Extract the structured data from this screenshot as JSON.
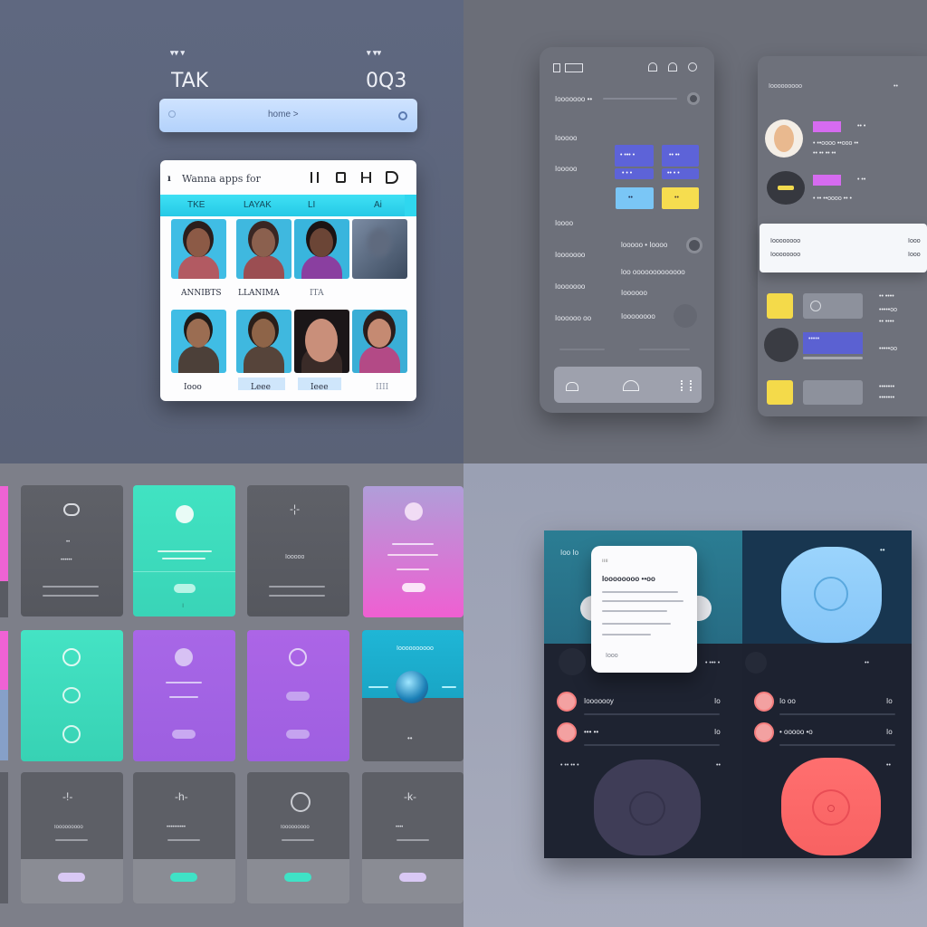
{
  "q1": {
    "status_left": "▾▾ ▾",
    "status_right": "▾ ▾▾",
    "big_left": "TAK",
    "big_right": "0Q3",
    "search_label": "home >",
    "card_title": "Wanna apps for",
    "card_icons": [
      "bars-icon",
      "grid-icon",
      "h-icon",
      "m-icon"
    ],
    "col_headers": [
      "TKE",
      "LAYAK",
      "LI",
      "Ai"
    ],
    "row1_captions": [
      "ANNIBTS",
      "LLANIMA",
      "ITA",
      ""
    ],
    "row2_captions": [
      "Iooo",
      "Leee",
      "Ieee",
      "IIII"
    ]
  },
  "q2": {
    "phone_top_icons": [
      "menu-icon",
      "home-icon",
      "lock-icon",
      "settings-icon"
    ],
    "phone_rows": [
      "Iooooooo ••",
      "Iooooo",
      "Iooooo",
      "Ioooo",
      "Iooooooo",
      "Iooooooo",
      "Ioooooo oo"
    ],
    "chip_labels": [
      "• ••• •",
      "•• ••",
      "• • •",
      "•• • •",
      "••",
      "••"
    ],
    "phone_mid_text": [
      "looooo • Ioooo",
      "loo ooooooooooooo",
      "Ioooooo",
      "Ioooooooo"
    ],
    "right_header": "Iooooooooo",
    "right_header_right": "••",
    "profile_lines": [
      "•• •",
      "• ••oooo ••ooo ••",
      "•• •• •• ••",
      "• ••",
      "• •• ••oooo •• •"
    ],
    "note_left": [
      "Ioooooooo",
      "Ioooooooo"
    ],
    "note_right": [
      "Iooo",
      "Iooo"
    ],
    "right_list": [
      "•• ••••",
      "•••••oo",
      "•• ••••",
      "•••••oo",
      "•••••••",
      "•••••••"
    ]
  },
  "q3": {
    "tile_texts": [
      "••",
      "Ioooooooooo",
      "••••••",
      "Iooooo",
      "Iooooooooo",
      "••••••••••",
      "Iooooooooo",
      "••••"
    ]
  },
  "q4": {
    "header_left": "Ioo Io",
    "header_right": "••",
    "popup_title": "Ioooooooo ••oo",
    "popup_foot": "Iooo",
    "row_labels": [
      "Iooooooy",
      "••• ••",
      "Io oo",
      "• ooooo •o"
    ],
    "row_right": [
      "Io",
      "Io",
      "Io",
      "Io"
    ],
    "mid_text": [
      "• ••• •",
      "• •• •• •"
    ],
    "colors": {
      "teal": "#2a7c92",
      "navy": "#173650",
      "panel": "#1e2331",
      "coral": "#ff6b6b",
      "sky": "#8ecdfa"
    }
  }
}
